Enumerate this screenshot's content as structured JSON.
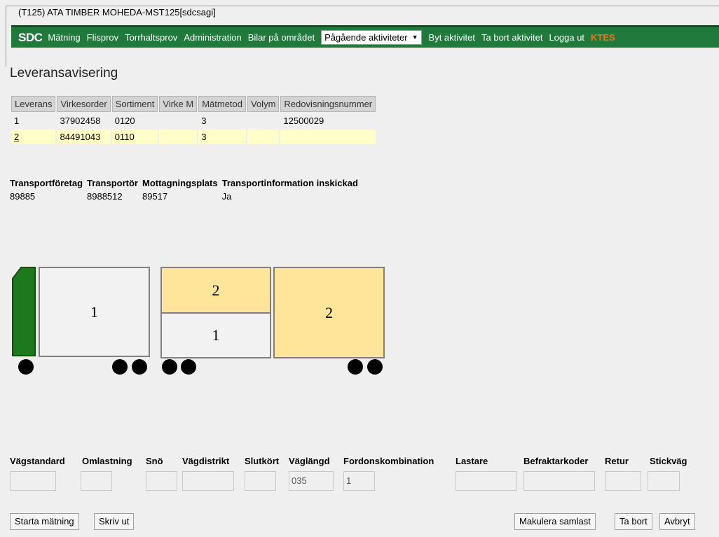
{
  "window": {
    "legend": "(T125) ATA TIMBER MOHEDA-MST125[sdcsagi]"
  },
  "nav": {
    "logo": "SDC",
    "links": [
      "Mätning",
      "Flisprov",
      "Torrhaltsprov",
      "Administration",
      "Bilar på området"
    ],
    "select_value": "Pågående aktiviteter",
    "actions": [
      "Byt aktivitet",
      "Ta bort aktivitet",
      "Logga ut"
    ],
    "warning": "KTES",
    "bg_color": "#1f7a3c",
    "warning_color": "#ff6a1a"
  },
  "page": {
    "title": "Leveransavisering"
  },
  "deliveries": {
    "columns": [
      "Leverans",
      "Virkesorder",
      "Sortiment",
      "Virke M",
      "Mätmetod",
      "Volym",
      "Redovisningsnummer"
    ],
    "rows": [
      [
        "1",
        "37902458",
        "0120",
        "",
        "3",
        "",
        "12500029"
      ],
      [
        "2",
        "84491043",
        "0110",
        "",
        "3",
        "",
        ""
      ]
    ],
    "highlight_color": "#ffffc9"
  },
  "transport": {
    "columns": [
      "Transportföretag",
      "Transportör",
      "Mottagningsplats",
      "Transportinformation inskickad"
    ],
    "values": [
      "89885",
      "8988512",
      "89517",
      "Ja"
    ]
  },
  "vehicle": {
    "truck_load": "1",
    "trailer_front_top": "2",
    "trailer_front_bottom": "1",
    "trailer_rear": "2",
    "cab_color": "#1c7a1c",
    "load_color_yellow": "#ffe59a"
  },
  "fields": {
    "labels": [
      "Vägstandard",
      "Omlastning",
      "Snö",
      "Vägdistrikt",
      "Slutkört",
      "Väglängd",
      "Fordonskombination",
      "Lastare",
      "Befraktarkoder",
      "Retur",
      "Stickväg"
    ],
    "values": [
      "",
      "",
      "",
      "",
      "",
      "035",
      "1",
      "",
      "",
      "",
      ""
    ]
  },
  "buttons": {
    "start": "Starta mätning",
    "print": "Skriv ut",
    "cancel_load": "Makulera samlast",
    "delete": "Ta bort",
    "abort": "Avbryt"
  }
}
